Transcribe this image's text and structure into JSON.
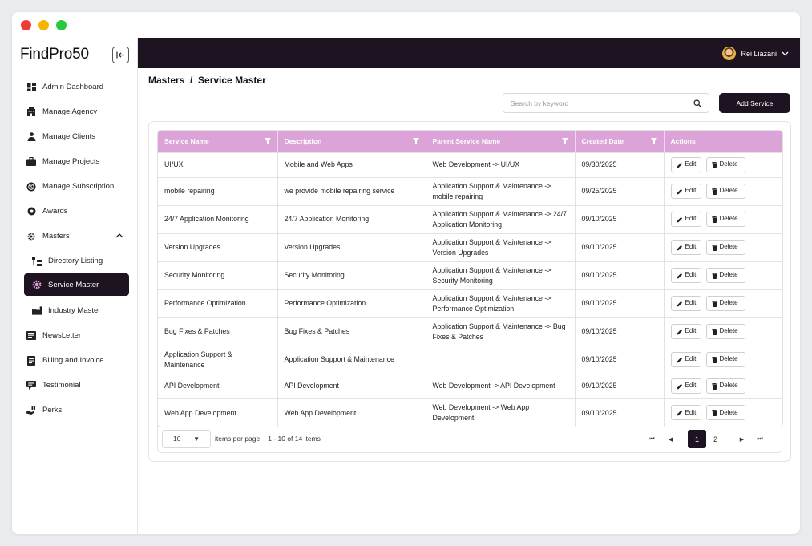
{
  "app": {
    "logo": "FindPro50"
  },
  "user": {
    "name": "Rei Liazani"
  },
  "sidebar": {
    "items": [
      {
        "label": "Admin Dashboard",
        "icon": "dashboard-icon"
      },
      {
        "label": "Manage Agency",
        "icon": "building-icon"
      },
      {
        "label": "Manage Clients",
        "icon": "clients-icon"
      },
      {
        "label": "Manage Projects",
        "icon": "projects-icon"
      },
      {
        "label": "Manage Subscription",
        "icon": "subscription-icon"
      },
      {
        "label": "Awards",
        "icon": "award-icon"
      },
      {
        "label": "Masters",
        "icon": "gear-icon"
      },
      {
        "label": "Directory Listing",
        "icon": "directory-icon"
      },
      {
        "label": "Service Master",
        "icon": "service-gear-icon"
      },
      {
        "label": "Industry Master",
        "icon": "industry-icon"
      },
      {
        "label": "NewsLetter",
        "icon": "newsletter-icon"
      },
      {
        "label": "Billing and Invoice",
        "icon": "invoice-icon"
      },
      {
        "label": "Testimonial",
        "icon": "testimonial-icon"
      },
      {
        "label": "Perks",
        "icon": "perks-icon"
      }
    ]
  },
  "breadcrumb": {
    "text": "Masters  /  Service Master"
  },
  "search": {
    "placeholder": "Search by keyword"
  },
  "add_button": {
    "label": "Add Service"
  },
  "table": {
    "headers": [
      "Service Name",
      "Description",
      "Parent Service Name",
      "Created Date",
      "Actions"
    ],
    "actions": {
      "edit": "Edit",
      "delete": "Delete"
    },
    "rows": [
      {
        "name": "UI/UX",
        "description": "Mobile and Web Apps",
        "parent": "Web Development -> UI/UX",
        "date": "09/30/2025"
      },
      {
        "name": "mobile repairing",
        "description": "we provide mobile repairing service",
        "parent": "Application Support & Maintenance -> mobile repairing",
        "date": "09/25/2025"
      },
      {
        "name": "24/7 Application Monitoring",
        "description": "24/7 Application Monitoring",
        "parent": "Application Support & Maintenance -> 24/7 Application Monitoring",
        "date": "09/10/2025"
      },
      {
        "name": "Version Upgrades",
        "description": "Version Upgrades",
        "parent": "Application Support & Maintenance -> Version Upgrades",
        "date": "09/10/2025"
      },
      {
        "name": "Security Monitoring",
        "description": "Security Monitoring",
        "parent": "Application Support & Maintenance -> Security Monitoring",
        "date": "09/10/2025"
      },
      {
        "name": "Performance Optimization",
        "description": "Performance Optimization",
        "parent": "Application Support & Maintenance -> Performance Optimization",
        "date": "09/10/2025"
      },
      {
        "name": "Bug Fixes & Patches",
        "description": "Bug Fixes & Patches",
        "parent": "Application Support & Maintenance -> Bug Fixes & Patches",
        "date": "09/10/2025"
      },
      {
        "name": "Application Support & Maintenance",
        "description": "Application Support & Maintenance",
        "parent": "",
        "date": "09/10/2025"
      },
      {
        "name": "API Development",
        "description": "API Development",
        "parent": "Web Development -> API Development",
        "date": "09/10/2025"
      },
      {
        "name": "Web App Development",
        "description": "Web App Development",
        "parent": "Web Development -> Web App Development",
        "date": "09/10/2025"
      }
    ]
  },
  "pagination": {
    "page_size": "10",
    "items_per_page_label": "items per page",
    "range": "1 - 10 of 14 items",
    "pages": [
      "1",
      "2"
    ],
    "current_page": "1"
  }
}
